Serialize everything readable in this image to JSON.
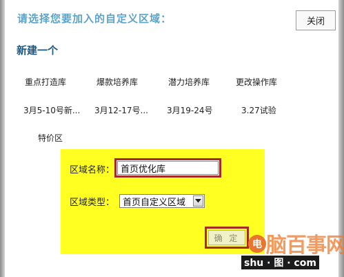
{
  "dialog": {
    "prompt": "请选择您要加入的自定义区域：",
    "close_label": "关闭"
  },
  "new_section": {
    "title": "新建一个"
  },
  "areas": [
    "重点打造库",
    "爆款培养库",
    "潜力培养库",
    "更改操作库",
    "3月5-10号新...",
    "3月12-17号...",
    "3月19-24号",
    "3.27试验",
    "特价区"
  ],
  "form": {
    "name_label": "区域名称：",
    "name_value": "首页优化库",
    "type_label": "区域类型：",
    "type_value": "首页自定义区域",
    "confirm_label": "确 定"
  },
  "watermark": {
    "circle_char": "电",
    "big_text": "脑百事网",
    "tag_text": "shu · 图 · com"
  },
  "colors": {
    "prompt": "#5da3c8",
    "section_title": "#1e5a82",
    "form_background": "#ffff21",
    "highlight_border": "#a62828"
  }
}
